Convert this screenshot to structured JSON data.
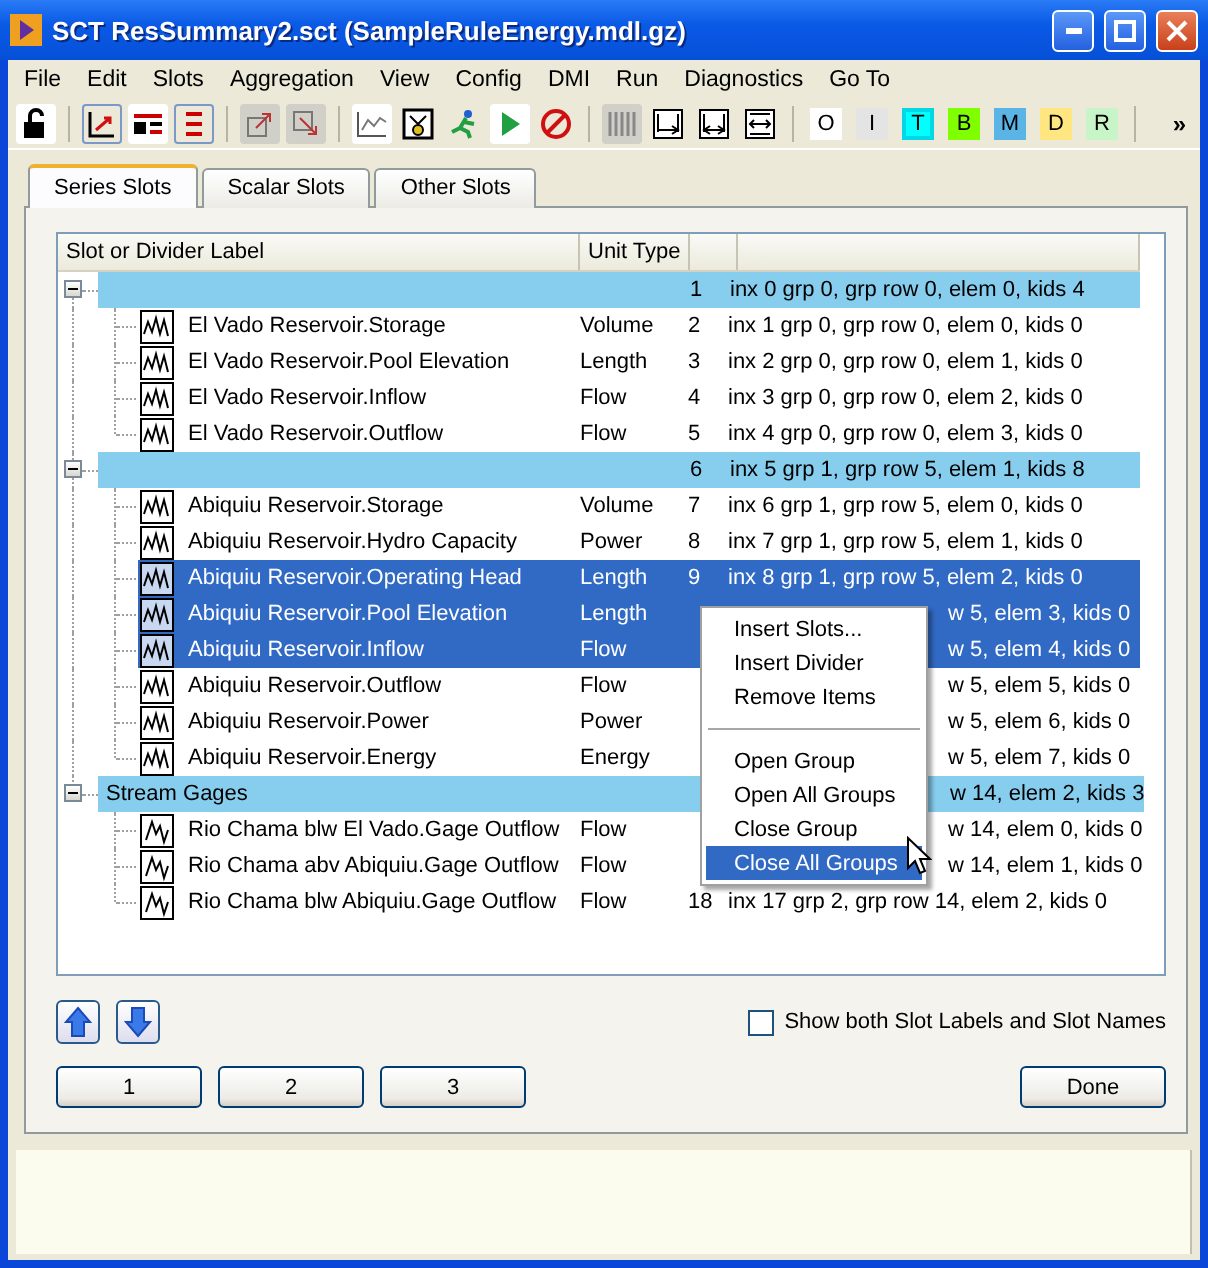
{
  "window": {
    "title": "SCT ResSummary2.sct (SampleRuleEnergy.mdl.gz)"
  },
  "menu": [
    "File",
    "Edit",
    "Slots",
    "Aggregation",
    "View",
    "Config",
    "DMI",
    "Run",
    "Diagnostics",
    "Go To"
  ],
  "toolbar": {
    "letters": [
      {
        "label": "O",
        "color": "#ffffff"
      },
      {
        "label": "I",
        "color": "#e4e4e4"
      },
      {
        "label": "T",
        "color": "#00ffff"
      },
      {
        "label": "B",
        "color": "#80ff00"
      },
      {
        "label": "M",
        "color": "#5ab4e6"
      },
      {
        "label": "D",
        "color": "#ffe680"
      },
      {
        "label": "R",
        "color": "#c8f5c8"
      }
    ],
    "overflow": "»"
  },
  "tabs": [
    {
      "label": "Series Slots",
      "selected": true
    },
    {
      "label": "Scalar Slots",
      "selected": false
    },
    {
      "label": "Other Slots",
      "selected": false
    }
  ],
  "table": {
    "columns": [
      "Slot or Divider Label",
      "Unit Type"
    ],
    "groups": [
      {
        "number": "1",
        "info": "inx 0 grp 0, grp row 0, elem 0, kids 4",
        "expanded": true,
        "children": [
          {
            "label": "El Vado Reservoir.Storage",
            "unit": "Volume",
            "number": "2",
            "info": "inx 1 grp 0, grp row 0, elem 0, kids 0",
            "selected": false
          },
          {
            "label": "El Vado Reservoir.Pool Elevation",
            "unit": "Length",
            "number": "3",
            "info": "inx 2 grp 0, grp row 0, elem 1, kids 0",
            "selected": false
          },
          {
            "label": "El Vado Reservoir.Inflow",
            "unit": "Flow",
            "number": "4",
            "info": "inx 3 grp 0, grp row 0, elem 2, kids 0",
            "selected": false
          },
          {
            "label": "El Vado Reservoir.Outflow",
            "unit": "Flow",
            "number": "5",
            "info": "inx 4 grp 0, grp row 0, elem 3, kids 0",
            "selected": false
          }
        ]
      },
      {
        "number": "6",
        "info": "inx 5 grp 1, grp row 5, elem 1, kids 8",
        "expanded": true,
        "children": [
          {
            "label": "Abiquiu Reservoir.Storage",
            "unit": "Volume",
            "number": "7",
            "info": "inx 6 grp 1, grp row 5, elem 0, kids 0",
            "selected": false
          },
          {
            "label": "Abiquiu Reservoir.Hydro Capacity",
            "unit": "Power",
            "number": "8",
            "info": "inx 7 grp 1, grp row 5, elem 1, kids 0",
            "selected": false
          },
          {
            "label": "Abiquiu Reservoir.Operating Head",
            "unit": "Length",
            "number": "9",
            "info": "inx 8 grp 1, grp row 5, elem 2, kids 0",
            "selected": true
          },
          {
            "label": "Abiquiu Reservoir.Pool Elevation",
            "unit": "Length",
            "info": "w 5, elem 3, kids 0",
            "selected": true
          },
          {
            "label": "Abiquiu Reservoir.Inflow",
            "unit": "Flow",
            "info": "w 5, elem 4, kids 0",
            "selected": true
          },
          {
            "label": "Abiquiu Reservoir.Outflow",
            "unit": "Flow",
            "info": "w 5, elem 5, kids 0",
            "selected": false
          },
          {
            "label": "Abiquiu Reservoir.Power",
            "unit": "Power",
            "info": "w 5, elem 6, kids 0",
            "selected": false
          },
          {
            "label": "Abiquiu Reservoir.Energy",
            "unit": "Energy",
            "info": "w 5, elem 7, kids 0",
            "selected": false
          }
        ]
      },
      {
        "label": "Stream Gages",
        "info": "w 14, elem 2, kids 3",
        "expanded": true,
        "children": [
          {
            "label": "Rio Chama blw El Vado.Gage Outflow",
            "unit": "Flow",
            "info": "w 14, elem 0, kids 0",
            "selected": false
          },
          {
            "label": "Rio Chama abv Abiquiu.Gage Outflow",
            "unit": "Flow",
            "info": "w 14, elem 1, kids 0",
            "selected": false
          },
          {
            "label": "Rio Chama blw Abiquiu.Gage Outflow",
            "unit": "Flow",
            "number": "18",
            "info": "inx 17 grp 2, grp row 14, elem 2, kids 0",
            "selected": false
          }
        ]
      }
    ]
  },
  "context_menu": [
    {
      "label": "Insert Slots...",
      "selected": false
    },
    {
      "label": "Insert Divider",
      "selected": false
    },
    {
      "label": "Remove Items",
      "selected": false
    },
    {
      "kind": "separator"
    },
    {
      "label": "Open Group",
      "selected": false
    },
    {
      "label": "Open All Groups",
      "selected": false
    },
    {
      "label": "Close Group",
      "selected": false
    },
    {
      "label": "Close All Groups",
      "selected": true
    }
  ],
  "checkbox": {
    "label": "Show both Slot Labels and Slot Names",
    "checked": false
  },
  "buttons": [
    "1",
    "2",
    "3"
  ],
  "done": "Done"
}
